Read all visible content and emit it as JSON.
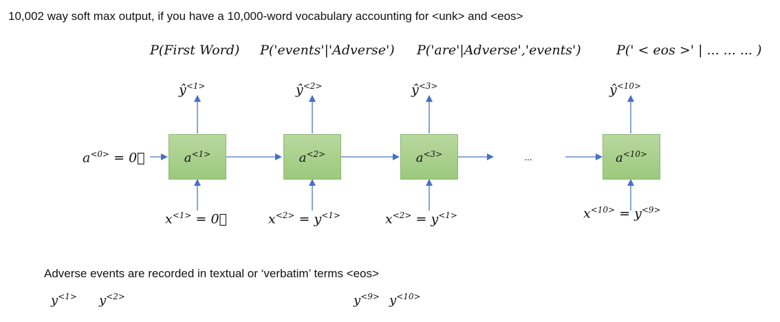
{
  "title": "10,002 way soft max output, if you have a 10,000-word vocabulary accounting for <unk> and <eos>",
  "probabilities": [
    "P(First Word)",
    "P('events'|'Adverse')",
    "P('are'|Adverse','events')",
    "P(' < eos >' | ... ... ... )"
  ],
  "outputs": [
    "ŷ<1>",
    "ŷ<2>",
    "ŷ<3>",
    "ŷ<10>"
  ],
  "cells": [
    "a<1>",
    "a<2>",
    "a<3>",
    "a<10>"
  ],
  "initial_state": "a<0> = 0⃗",
  "ellipsis": "...",
  "inputs": [
    "x<1> = 0⃗",
    "x<2> = y<1>",
    "x<2> = y<1>",
    "x<10> = y<9>"
  ],
  "sentence": "Adverse events are recorded in textual or ‘verbatim’ terms <eos>",
  "targets": [
    "y<1>",
    "y<2>",
    "y<9>",
    "y<10>"
  ],
  "colors": {
    "cell_fill": "#9cc97d",
    "arrow": "#4472c4"
  }
}
